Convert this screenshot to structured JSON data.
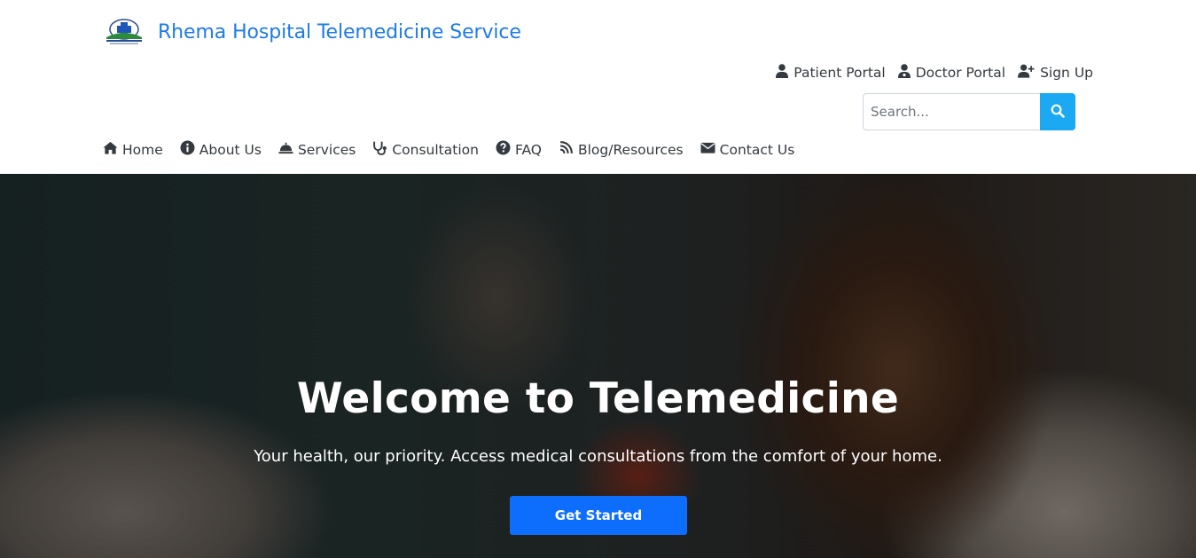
{
  "brand": {
    "title": "Rhema Hospital Telemedicine Service",
    "logo_icon": "hospital-logo"
  },
  "portal_links": [
    {
      "label": "Patient Portal",
      "icon": "user-icon"
    },
    {
      "label": "Doctor Portal",
      "icon": "user-doctor-icon"
    },
    {
      "label": "Sign Up",
      "icon": "user-plus-icon"
    }
  ],
  "search": {
    "placeholder": "Search...",
    "value": "",
    "button_icon": "search-icon"
  },
  "nav": [
    {
      "label": "Home",
      "icon": "home-icon"
    },
    {
      "label": "About Us",
      "icon": "info-circle-icon"
    },
    {
      "label": "Services",
      "icon": "bell-concierge-icon"
    },
    {
      "label": "Consultation",
      "icon": "stethoscope-icon"
    },
    {
      "label": "FAQ",
      "icon": "question-circle-icon"
    },
    {
      "label": "Blog/Resources",
      "icon": "blog-icon"
    },
    {
      "label": "Contact Us",
      "icon": "envelope-icon"
    }
  ],
  "hero": {
    "title": "Welcome to Telemedicine",
    "subtitle": "Your health, our priority. Access medical consultations from the comfort of your home.",
    "cta_label": "Get Started"
  },
  "colors": {
    "brand": "#1e7be6",
    "search_button": "#1aa9f2",
    "cta": "#0d6efd",
    "text": "#343a40"
  }
}
